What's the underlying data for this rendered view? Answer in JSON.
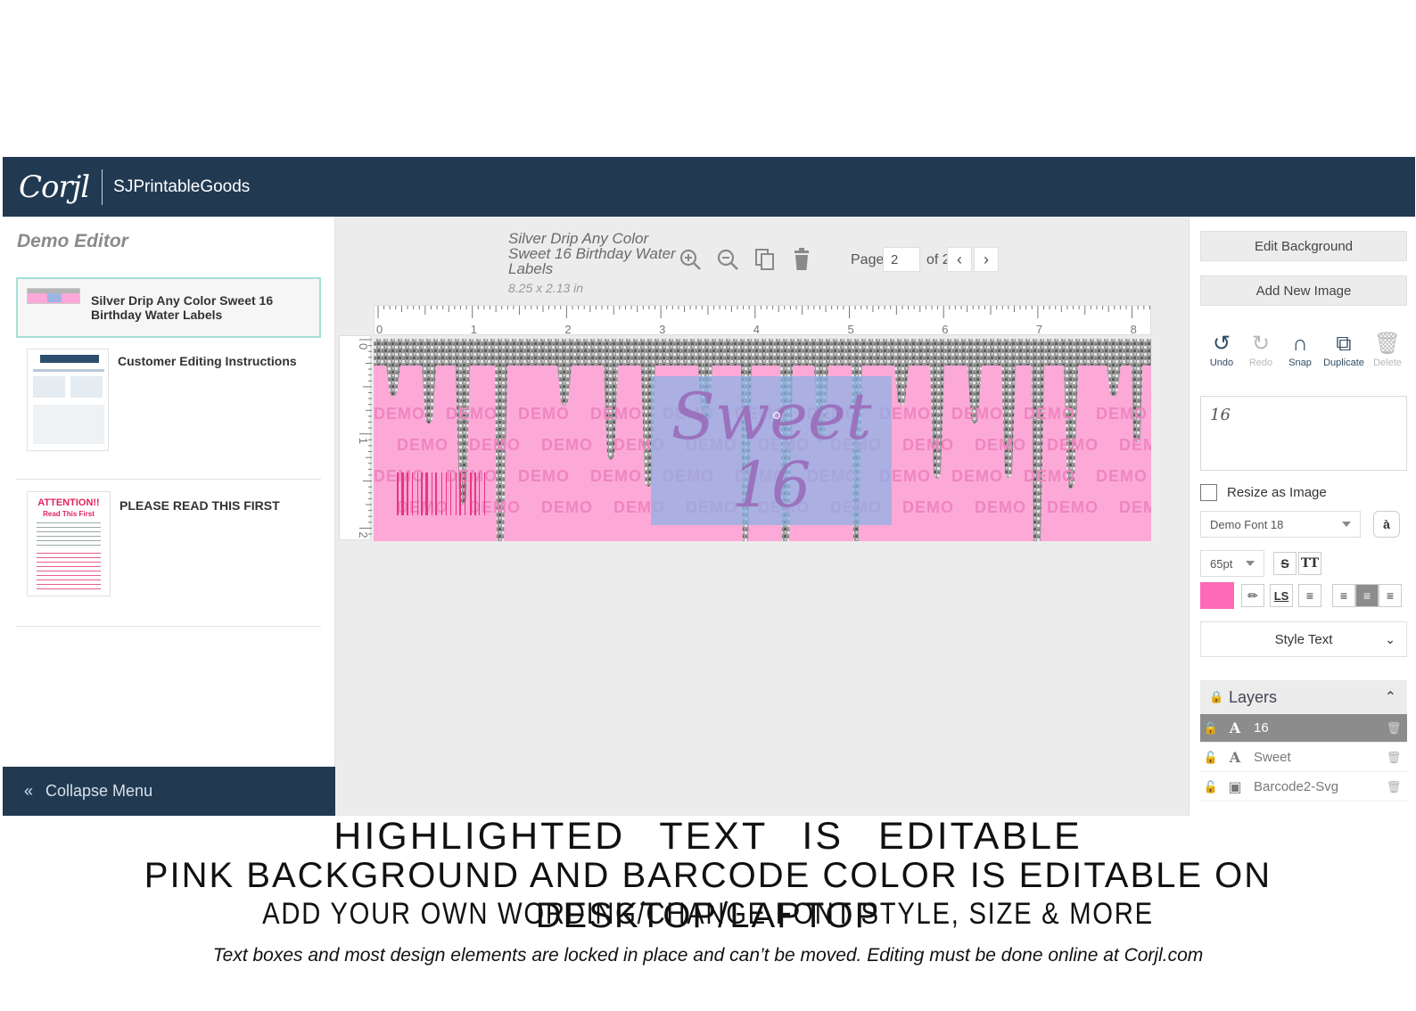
{
  "topbar": {
    "logo": "Corjl",
    "shop_name": "SJPrintableGoods"
  },
  "sidebar": {
    "title": "Demo Editor",
    "pages": [
      {
        "label": "Silver Drip Any Color Sweet 16 Birthday Water Labels",
        "active": true
      },
      {
        "label": "Customer Editing Instructions",
        "active": false
      },
      {
        "label": "PLEASE READ THIS FIRST",
        "active": false
      }
    ],
    "thumb_attention_title": "ATTENTION!!",
    "thumb_attention_sub": "Read This First",
    "collapse_label": "Collapse Menu"
  },
  "canvas": {
    "doc_title": "Silver Drip Any Color Sweet 16 Birthday Water Labels",
    "doc_size": "8.25 x 2.13 in",
    "page_label": "Page",
    "page_current": "2",
    "page_of": "of 2",
    "ruler_h_labels": [
      "0",
      "1",
      "2",
      "3",
      "4",
      "5",
      "6",
      "7",
      "8"
    ],
    "ruler_v_labels": [
      "0",
      "1",
      "2"
    ],
    "label_line1": "Sweet",
    "label_line2": "16",
    "watermark": "DEMO",
    "background_color": "#fca9d8"
  },
  "right_panel": {
    "edit_background": "Edit Background",
    "add_new_image": "Add New Image",
    "actions": [
      {
        "label": "Undo",
        "icon": "undo-icon",
        "enabled": true
      },
      {
        "label": "Redo",
        "icon": "redo-icon",
        "enabled": false
      },
      {
        "label": "Snap",
        "icon": "magnet-icon",
        "enabled": true
      },
      {
        "label": "Duplicate",
        "icon": "duplicate-icon",
        "enabled": true
      },
      {
        "label": "Delete",
        "icon": "trash-icon",
        "enabled": false
      }
    ],
    "text_value": "16",
    "resize_as_image": "Resize as Image",
    "font_name": "Demo Font 18",
    "font_size": "65pt",
    "text_color": "#fe6ab8",
    "style_text": "Style Text",
    "layers_title": "Layers",
    "layers": [
      {
        "name": "16",
        "type": "text",
        "active": true
      },
      {
        "name": "Sweet",
        "type": "text",
        "active": false
      },
      {
        "name": "Barcode2-Svg",
        "type": "image",
        "active": false
      }
    ]
  },
  "captions": {
    "line1": "HIGHLIGHTED TEXT IS EDITABLE",
    "line2": "PINK BACKGROUND AND BARCODE COLOR IS EDITABLE ON DESKTOP/LAPTOP",
    "line3": "ADD YOUR OWN WORDING/CHANGE FONT STYLE, SIZE & MORE",
    "line4": "Text boxes and most design elements are locked in place and can’t be moved. Editing must be done online at Corjl.com"
  }
}
